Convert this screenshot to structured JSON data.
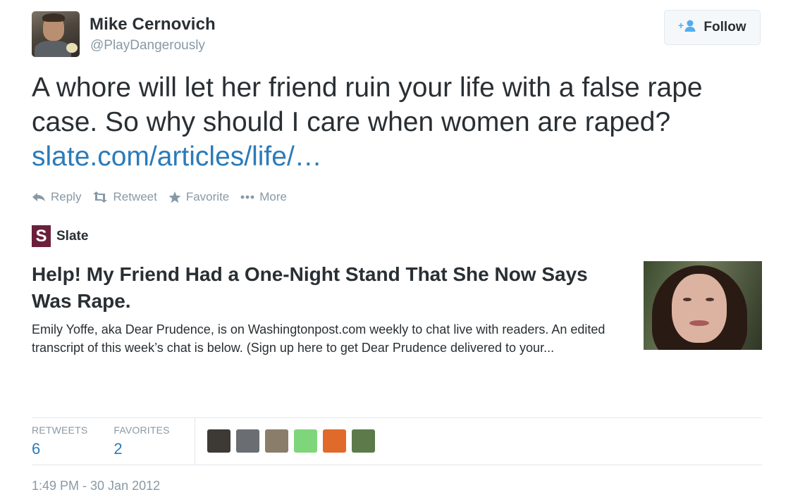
{
  "user": {
    "name": "Mike Cernovich",
    "handle": "@PlayDangerously"
  },
  "follow_button": {
    "label": "Follow"
  },
  "tweet": {
    "line1": "A whore will let her friend ruin your life with a false rape",
    "line2": "case. So why should I care when women are raped?",
    "link": "slate.com/articles/life/…"
  },
  "actions": {
    "reply": "Reply",
    "retweet": "Retweet",
    "favorite": "Favorite",
    "more": "More"
  },
  "card": {
    "source_logo": "S",
    "source_name": "Slate",
    "title": "Help! My Friend Had a One-Night Stand That She Now Says Was Rape.",
    "description": "Emily Yoffe, aka Dear Prudence, is on Washingtonpost.com weekly to chat live with readers. An edited transcript of this week’s chat is below. (Sign up here to get Dear Prudence delivered to your..."
  },
  "stats": {
    "retweets_label": "RETWEETS",
    "retweets_value": "6",
    "favorites_label": "FAVORITES",
    "favorites_value": "2"
  },
  "favoriter_avatars": [
    {
      "color": "#3d3a36"
    },
    {
      "color": "#6a6e72"
    },
    {
      "color": "#8a7d6a"
    },
    {
      "color": "#7fd57a"
    },
    {
      "color": "#e06a2a"
    },
    {
      "color": "#5c7a4a"
    }
  ],
  "timestamp": "1:49 PM - 30 Jan 2012",
  "colors": {
    "link": "#2b7bb9",
    "muted": "#8899a6",
    "text": "#292f33",
    "slate_brand": "#6b1f3a"
  }
}
